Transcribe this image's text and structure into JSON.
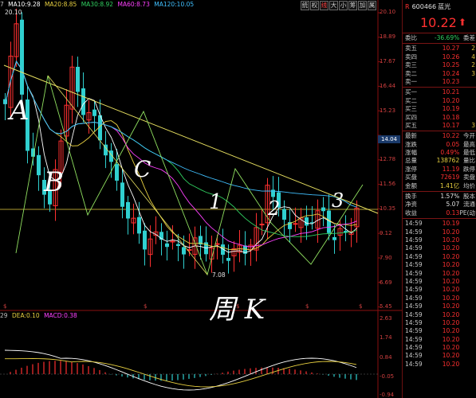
{
  "chart": {
    "ma_legend": [
      {
        "label": "7",
        "color": "#c0c0c0"
      },
      {
        "label": "MA10:9.28",
        "color": "#ffffff"
      },
      {
        "label": "MA20:8.85",
        "color": "#e8d040"
      },
      {
        "label": "MA30:8.92",
        "color": "#30d060"
      },
      {
        "label": "MA60:8.73",
        "color": "#ff40ff"
      },
      {
        "label": "MA120:10.05",
        "color": "#40c0ff"
      }
    ],
    "high_marker": "20.10",
    "low_marker": "7.08",
    "current_price_tag": "14.04",
    "y_ticks": [
      "20.10",
      "18.89",
      "17.67",
      "16.44",
      "15.23",
      "14.04",
      "12.78",
      "11.56",
      "10.35",
      "9.12",
      "7.90",
      "6.69",
      "5.45"
    ],
    "macd_y_ticks": [
      "2.63",
      "1.74",
      "0.84",
      "-0.05",
      "-0.94"
    ],
    "macd_legend": [
      {
        "label": "29",
        "color": "#c0c0c0"
      },
      {
        "label": "DEA:0.10",
        "color": "#e8d040"
      },
      {
        "label": "MACD:0.38",
        "color": "#ff40ff"
      }
    ],
    "annotations": {
      "A": "A",
      "B": "B",
      "C": "C",
      "one": "1",
      "two": "2",
      "three": "3",
      "weekly": "周 K"
    },
    "six_marks": [
      "$",
      "$",
      "$",
      "$",
      "$"
    ]
  },
  "toolbar": [
    "统",
    "权",
    "线",
    "大",
    "小",
    "筹",
    "加",
    "属"
  ],
  "panel": {
    "stock_code": "600466",
    "stock_name": "蓝光",
    "price": "10.22",
    "weibi": {
      "label": "委比",
      "value": "-36.69%",
      "extra": "委差"
    },
    "asks": [
      {
        "label": "卖五",
        "price": "10.27",
        "vol": "2"
      },
      {
        "label": "卖四",
        "price": "10.26",
        "vol": "4"
      },
      {
        "label": "卖三",
        "price": "10.25",
        "vol": "2"
      },
      {
        "label": "卖二",
        "price": "10.24",
        "vol": "3"
      },
      {
        "label": "卖一",
        "price": "10.23",
        "vol": ""
      }
    ],
    "bids": [
      {
        "label": "买一",
        "price": "10.21",
        "vol": ""
      },
      {
        "label": "买二",
        "price": "10.20",
        "vol": ""
      },
      {
        "label": "买三",
        "price": "10.19",
        "vol": ""
      },
      {
        "label": "买四",
        "price": "10.18",
        "vol": ""
      },
      {
        "label": "买五",
        "price": "10.17",
        "vol": "3"
      }
    ],
    "stats": [
      {
        "label": "最新",
        "value": "10.22",
        "extra": "今开",
        "color": "red"
      },
      {
        "label": "涨跌",
        "value": "0.05",
        "extra": "最高",
        "color": "red"
      },
      {
        "label": "涨幅",
        "value": "0.49%",
        "extra": "最低",
        "color": "red"
      },
      {
        "label": "总量",
        "value": "138762",
        "extra": "量比",
        "color": "yellow"
      },
      {
        "label": "涨停",
        "value": "11.19",
        "extra": "跌停",
        "color": "red"
      },
      {
        "label": "买盘",
        "value": "72619",
        "extra": "卖盘",
        "color": "red"
      },
      {
        "label": "金额",
        "value": "1.41亿",
        "extra": "均价",
        "color": "yellow"
      },
      {
        "label": "换手",
        "value": "1.57%",
        "extra": "股本",
        "color": "white"
      },
      {
        "label": "净资",
        "value": "5.07",
        "extra": "流通",
        "color": "white"
      },
      {
        "label": "收益",
        "value": "0.13",
        "extra": "PE(动",
        "color": "red"
      }
    ],
    "ticks": [
      {
        "time": "14:59",
        "price": "10.19"
      },
      {
        "time": "14:59",
        "price": "10.20"
      },
      {
        "time": "14:59",
        "price": "10.20"
      },
      {
        "time": "14:59",
        "price": "10.20"
      },
      {
        "time": "14:59",
        "price": "10.20"
      },
      {
        "time": "14:59",
        "price": "10.20"
      },
      {
        "time": "14:59",
        "price": "10.20"
      },
      {
        "time": "14:59",
        "price": "10.20"
      },
      {
        "time": "14:59",
        "price": "10.20"
      },
      {
        "time": "14:59",
        "price": "10.20"
      },
      {
        "time": "14:59",
        "price": "10.20"
      },
      {
        "time": "14:59",
        "price": "10.20"
      },
      {
        "time": "14:59",
        "price": "10.20"
      },
      {
        "time": "14:59",
        "price": "10.20"
      },
      {
        "time": "14:59",
        "price": "10.20"
      },
      {
        "time": "14:59",
        "price": "10.20"
      },
      {
        "time": "14:59",
        "price": "10.20"
      },
      {
        "time": "14:59",
        "price": "10.20"
      }
    ]
  }
}
